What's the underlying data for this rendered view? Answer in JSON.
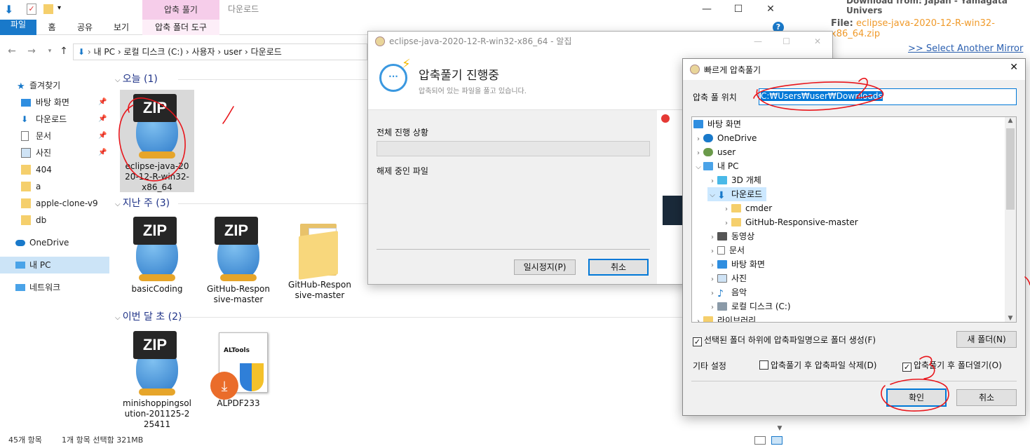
{
  "explorer": {
    "ctx_tab": "압축 풀기",
    "ctx_title": "다운로드",
    "ribbon": [
      "파일",
      "홈",
      "공유",
      "보기",
      "압축 폴더 도구"
    ],
    "help": "?",
    "breadcrumb": "내 PC  ›  로컬 디스크 (C:)  ›  사용자  ›  user  ›  다운로드",
    "sidebar": [
      "즐겨찾기",
      "바탕 화면",
      "다운로드",
      "문서",
      "사진",
      "404",
      "a",
      "apple-clone-v9",
      "db",
      "OneDrive",
      "내 PC",
      "네트워크"
    ],
    "groups": [
      "오늘 (1)",
      "지난 주 (3)",
      "이번 달 초 (2)"
    ],
    "files": {
      "today": [
        "eclipse-java-2020-12-R-win32-x86_64"
      ],
      "lastweek": [
        "basicCoding",
        "GitHub-Responsive-master",
        "GitHub-Responsive-master"
      ],
      "month": [
        "minishoppingsolution-201125-225411",
        "ALPDF233"
      ]
    },
    "zip_label": "ZIP",
    "altools_label": "ALTools",
    "status": [
      "45개 항목",
      "1개 항목 선택함 321MB"
    ]
  },
  "progress": {
    "title": "eclipse-java-2020-12-R-win32-x86_64 - 알집",
    "heading": "압축풀기 진행중",
    "subheading": "압축되어 있는 파일을 풀고 있습니다.",
    "overall": "전체 진행 상황",
    "current": "해제 중인 파일",
    "pause": "일시정지(P)",
    "cancel": "취소",
    "progress_fraction": 0
  },
  "extract": {
    "title": "빠르게 압축풀기",
    "location_label": "압축 풀 위치",
    "location_value": "C:₩Users₩user₩Downloads",
    "tree": [
      "바탕 화면",
      "OneDrive",
      "user",
      "내 PC",
      "3D 개체",
      "다운로드",
      "cmder",
      "GitHub-Responsive-master",
      "동영상",
      "문서",
      "바탕 화면",
      "사진",
      "음악",
      "로컬 디스크 (C:)",
      "라이브러리"
    ],
    "create_folder": "선택된 폴더 하위에 압축파일명으로 폴더 생성(F)",
    "new_folder": "새 폴더(N)",
    "other": "기타 설정",
    "delete_after": "압축풀기 후 압축파일 삭제(D)",
    "open_after": "압축풀기 후 폴더열기(O)",
    "ok": "확인",
    "cancel": "취소"
  },
  "web": {
    "download_from": "Download from: Japan - Yamagata Univers",
    "file_label": "File:",
    "file_name": "eclipse-java-2020-12-R-win32-x86_64.zip",
    "mirror": ">> Select Another Mirror"
  },
  "colors": {
    "accent": "#0078d7",
    "context_tab": "#f6cdea",
    "annotation": "#e8151b"
  }
}
